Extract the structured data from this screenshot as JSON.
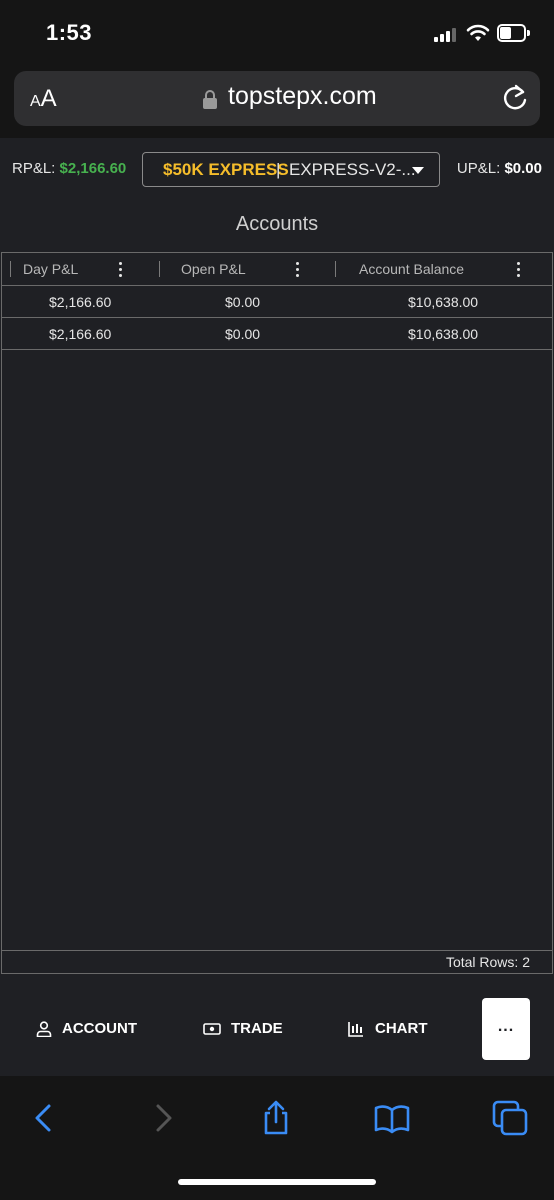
{
  "status_bar": {
    "time": "1:53"
  },
  "browser": {
    "aa_small": "A",
    "aa_large": "A",
    "url": "topstepx.com"
  },
  "header": {
    "rpl_label": "RP&L:",
    "rpl_value": "$2,166.60",
    "upl_label": "UP&L:",
    "upl_value": "$0.00",
    "account_tag": "$50K EXPRESS",
    "account_sep": "|",
    "account_name": "EXPRESS-V2-..."
  },
  "section_title": "Accounts",
  "grid": {
    "columns": [
      "Day P&L",
      "Open P&L",
      "Account Balance"
    ],
    "rows": [
      [
        "$2,166.60",
        "$0.00",
        "$10,638.00"
      ],
      [
        "$2,166.60",
        "$0.00",
        "$10,638.00"
      ]
    ],
    "total_rows": "Total Rows: 2"
  },
  "app_nav": {
    "items": [
      {
        "label": "ACCOUNT",
        "icon": "person-icon"
      },
      {
        "label": "TRADE",
        "icon": "cash-icon"
      },
      {
        "label": "CHART",
        "icon": "chart-icon"
      }
    ],
    "more_label": "..."
  },
  "colors": {
    "accent_gold": "#f5bd2b",
    "profit_green": "#47b14f",
    "safari_blue": "#3a8cf5"
  }
}
